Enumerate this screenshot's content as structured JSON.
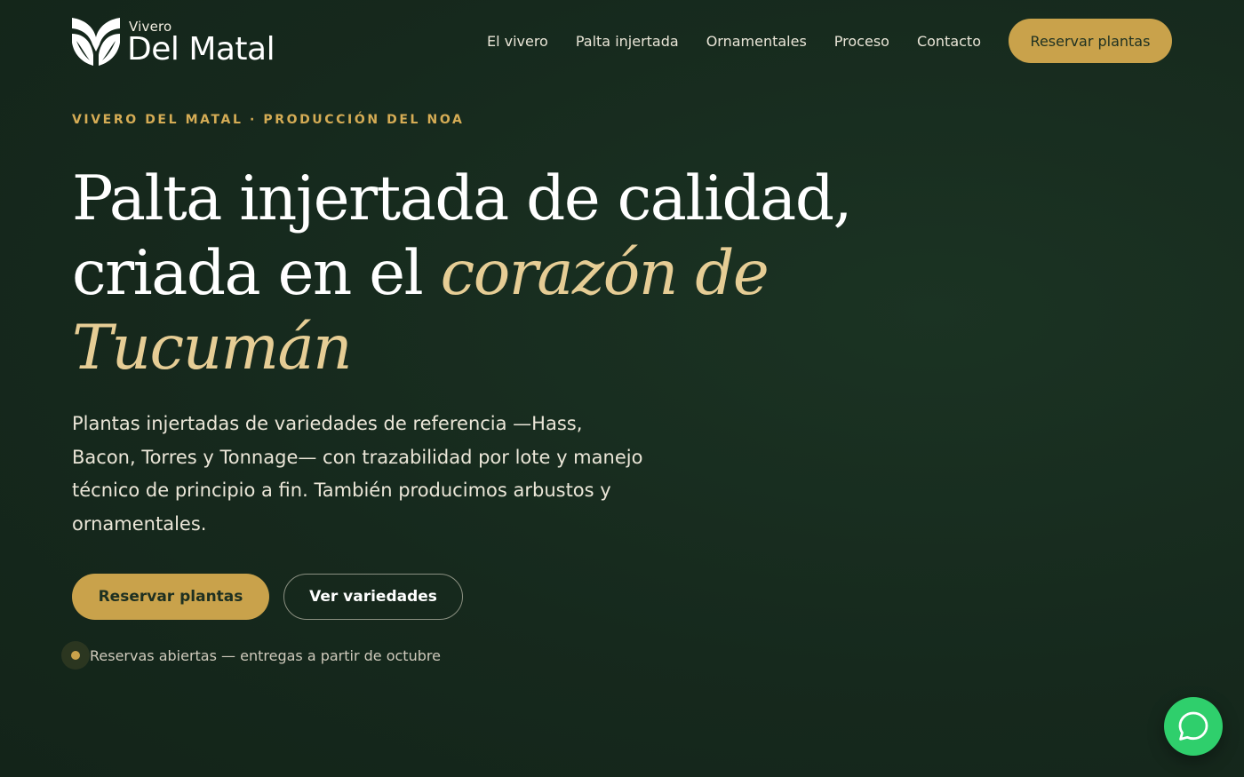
{
  "header": {
    "brand": {
      "small": "Vivero",
      "name": "Del Matal",
      "logo_icon": "leaf-logo-icon"
    },
    "nav": [
      {
        "label": "El vivero"
      },
      {
        "label": "Palta injertada"
      },
      {
        "label": "Ornamentales"
      },
      {
        "label": "Proceso"
      },
      {
        "label": "Contacto"
      }
    ],
    "cta_label": "Reservar plantas"
  },
  "hero": {
    "eyebrow": "VIVERO DEL MATAL · PRODUCCIÓN DEL NOA",
    "headline": {
      "line1": "Palta injertada de calidad,",
      "line2_plain": "criada en el ",
      "line2_accent": "corazón de",
      "line3_accent": "Tucumán"
    },
    "lede": "Plantas injertadas de variedades de referencia —Hass, Bacon, Torres y Tonnage— con trazabilidad por lote y manejo técnico de principio a fin. También producimos arbustos y ornamentales.",
    "primary_cta": "Reservar plantas",
    "secondary_cta": "Ver variedades",
    "status": "Reservas abiertas — entregas a partir de octubre"
  },
  "chat": {
    "icon": "chat-bubble-icon"
  },
  "colors": {
    "background": "#16291d",
    "accent_gold": "#c9a24b",
    "headline_accent": "#e6cd95",
    "chat_green": "#2fcf6c"
  }
}
